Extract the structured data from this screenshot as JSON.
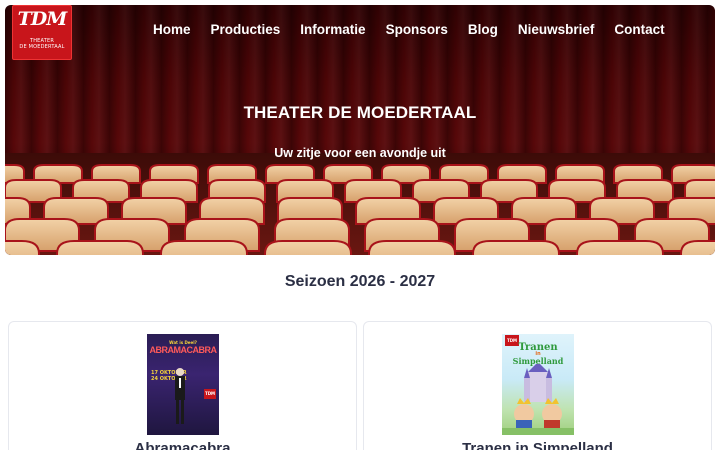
{
  "brand": {
    "logo_main": "TDM",
    "logo_sub_1": "THEATER",
    "logo_sub_2": "DE MOEDERTAAL"
  },
  "nav": {
    "items": [
      "Home",
      "Producties",
      "Informatie",
      "Sponsors",
      "Blog",
      "Nieuwsbrief",
      "Contact"
    ]
  },
  "hero": {
    "title": "THEATER DE MOEDERTAAL",
    "subtitle": "Uw zitje voor een avondje uit"
  },
  "season": {
    "title": "Seizoen 2026 - 2027"
  },
  "productions": [
    {
      "title": "Abramacabra",
      "poster_top": "Wat is Deel?",
      "poster_title": "ABRAMACABRA",
      "poster_dates": "17 OKTOBER\n24 OKTOBER",
      "poster_logo": "TDM"
    },
    {
      "title": "Tranen in Simpelland",
      "poster_logo": "TDM",
      "poster_title_1": "Tranen",
      "poster_title_2": "in",
      "poster_title_3": "Simpelland"
    }
  ],
  "colors": {
    "brand_red": "#c8151b",
    "text_dark": "#2b2f44",
    "curtain": "#6e0b0d"
  }
}
